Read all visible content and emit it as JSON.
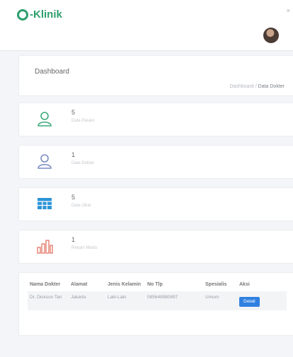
{
  "app": {
    "brand": "-Klinik"
  },
  "dashboard": {
    "title": "Dashboard",
    "breadcrumb": {
      "parent": "Dashboard",
      "separator": "/",
      "current": "Data Dokter"
    }
  },
  "stats": [
    {
      "value": "5",
      "label": "Data Pasien",
      "icon": "user-icon",
      "color": "#3dab7a"
    },
    {
      "value": "1",
      "label": "Data Dokter",
      "icon": "user-outline-icon",
      "color": "#7b8cc4"
    },
    {
      "value": "5",
      "label": "Data Obat",
      "icon": "table-icon",
      "color": "#2c93d6"
    },
    {
      "value": "1",
      "label": "Rekam Medis",
      "icon": "bar-chart-icon",
      "color": "#e57f6f"
    }
  ],
  "table": {
    "headers": [
      "Nama Dokter",
      "Alamat",
      "Jenis Kelamin",
      "No Tlp",
      "Spesialis",
      "Aksi"
    ],
    "rows": [
      {
        "nama": "Dr. Dickson Tan",
        "alamat": "Jakarta",
        "jk": "Laki-Laki",
        "tlp": "085648980897",
        "spesialis": "Umum",
        "aksi": "Detail"
      }
    ]
  },
  "colors": {
    "brand": "#2e9e6b",
    "button": "#2f80e0"
  }
}
